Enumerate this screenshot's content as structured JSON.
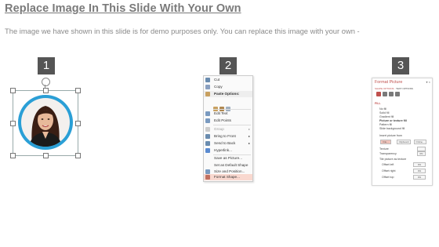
{
  "slide": {
    "title": "Replace Image In This Slide With Your Own",
    "subtitle": "The image we have shown in this slide is for demo purposes only. You can replace this image with your own -"
  },
  "steps": [
    "1",
    "2",
    "3"
  ],
  "context_menu": {
    "items": [
      {
        "label": "Cut",
        "icon": "scissors-icon"
      },
      {
        "label": "Copy",
        "icon": "copy-icon"
      },
      {
        "label": "Paste Options:",
        "icon": "clipboard-icon"
      },
      {
        "label": "Edit Text",
        "icon": "text-icon"
      },
      {
        "label": "Edit Points",
        "icon": "points-icon"
      },
      {
        "label": "Group",
        "icon": "group-icon"
      },
      {
        "label": "Bring to Front",
        "icon": "bring-front-icon"
      },
      {
        "label": "Send to Back",
        "icon": "send-back-icon"
      },
      {
        "label": "Hyperlink...",
        "icon": "link-icon"
      },
      {
        "label": "Save as Picture...",
        "icon": ""
      },
      {
        "label": "Set as Default Shape",
        "icon": ""
      },
      {
        "label": "Size and Position...",
        "icon": "size-icon"
      },
      {
        "label": "Format Shape...",
        "icon": "format-icon"
      }
    ]
  },
  "format_pane": {
    "title": "Format Picture",
    "tabs": [
      "SHAPE OPTIONS",
      "TEXT OPTIONS"
    ],
    "section": "FILL",
    "options": [
      "No fill",
      "Solid fill",
      "Gradient fill",
      "Picture or texture fill",
      "Pattern fill",
      "Slide background fill"
    ],
    "insert_label": "Insert picture from",
    "buttons": [
      "File...",
      "Clipboard",
      "Online..."
    ],
    "texture_label": "Texture",
    "transparency_label": "Transparency",
    "transparency_value": "0%",
    "tile_label": "Tile picture as texture",
    "offsets": [
      "Offset left",
      "Offset right",
      "Offset top"
    ],
    "offset_values": [
      "0%",
      "0%",
      "0%"
    ]
  }
}
